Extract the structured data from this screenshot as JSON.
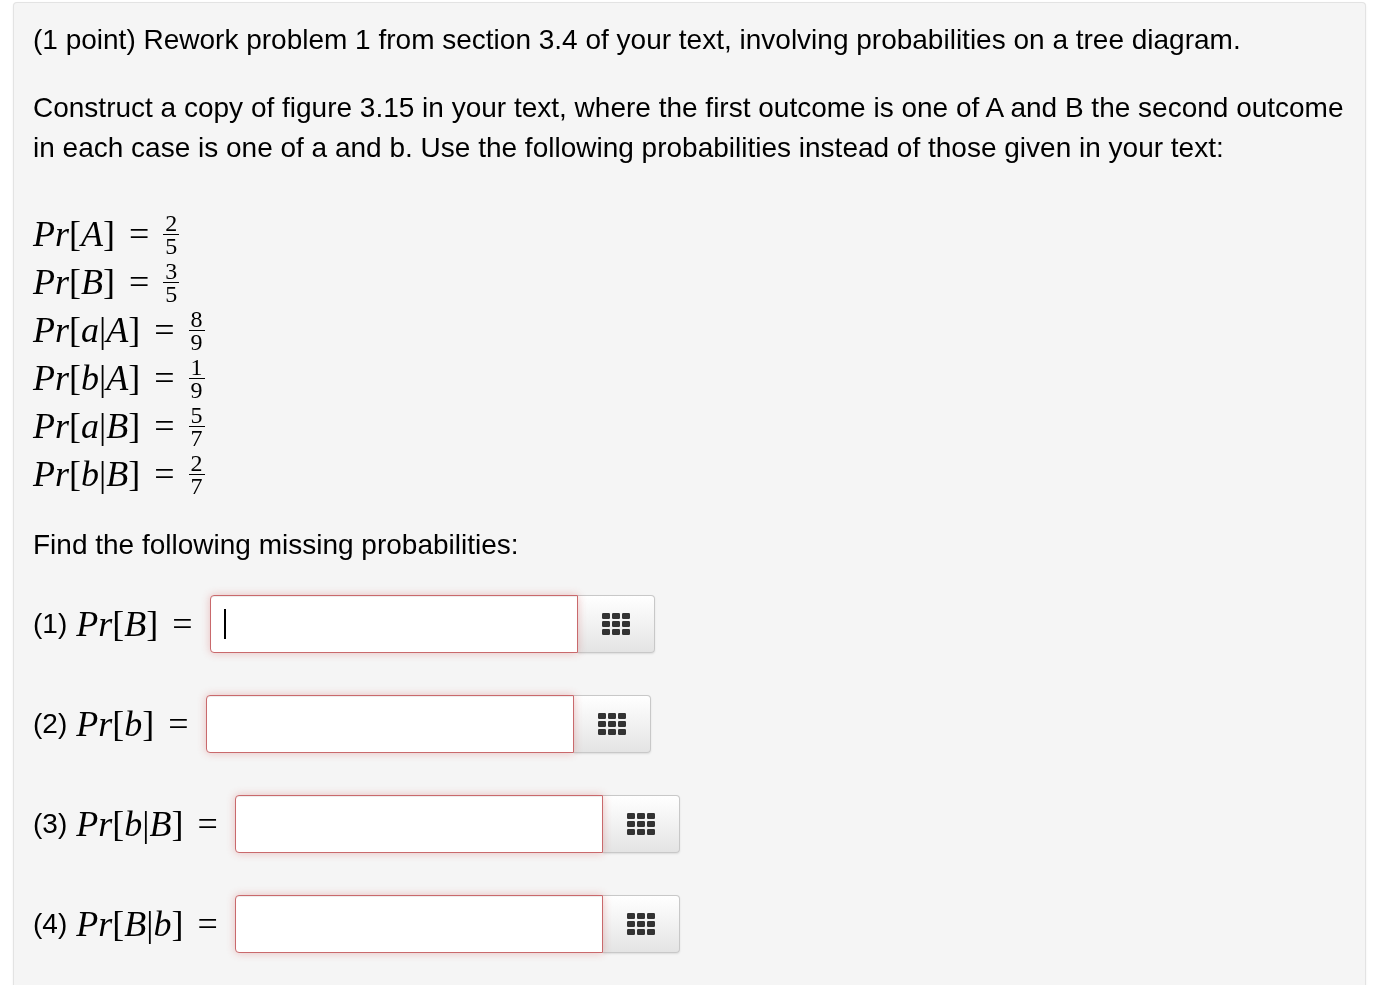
{
  "title": "(1 point) Rework problem 1 from section 3.4 of your text, involving probabilities on a tree diagram.",
  "intro": "Construct a copy of figure 3.15 in your text, where the first outcome is one of A and B the second outcome in each case is one of a and b. Use the following probabilities instead of those given in your text:",
  "given": [
    {
      "expression": "*Pr*[*A*] =",
      "numerator": "2",
      "denominator": "5"
    },
    {
      "expression": "*Pr*[*B*] =",
      "numerator": "3",
      "denominator": "5"
    },
    {
      "expression": "*Pr*[*a*|*A*] =",
      "numerator": "8",
      "denominator": "9"
    },
    {
      "expression": "*Pr*[*b*|*A*] =",
      "numerator": "1",
      "denominator": "9"
    },
    {
      "expression": "*Pr*[*a*|*B*] =",
      "numerator": "5",
      "denominator": "7"
    },
    {
      "expression": "*Pr*[*b*|*B*] =",
      "numerator": "2",
      "denominator": "7"
    }
  ],
  "instruction": "Find the following missing probabilities:",
  "answers": [
    {
      "number": "(1)",
      "expression": "*Pr*[*B*] =",
      "focused": true
    },
    {
      "number": "(2)",
      "expression": "*Pr*[*b*] =",
      "focused": false
    },
    {
      "number": "(3)",
      "expression": "*Pr*[*b*|*B*] =",
      "focused": false
    },
    {
      "number": "(4)",
      "expression": "*Pr*[*B*|*b*] =",
      "focused": false
    }
  ]
}
